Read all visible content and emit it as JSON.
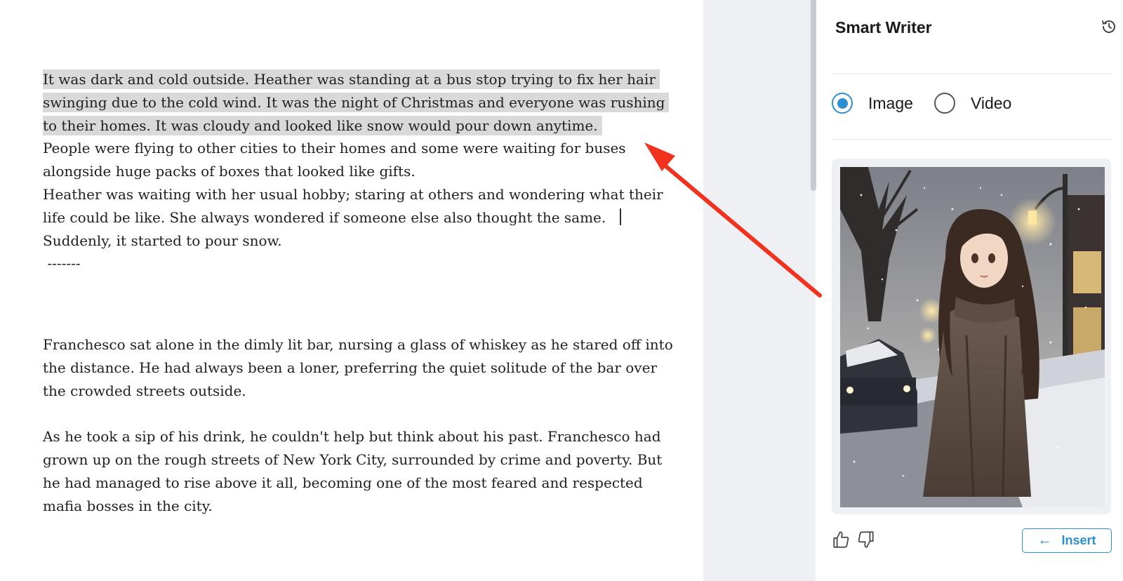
{
  "editor": {
    "highlighted_paragraph": "It was dark and cold outside. Heather was standing at a bus stop trying to fix her hair swinging due to the cold wind. It was the night of Christmas and everyone was rushing to their homes. It was cloudy and looked like snow would pour down anytime.",
    "paragraph_2": "People were flying to other cities to their homes and some were waiting for buses alongside huge packs of boxes that looked like gifts.",
    "paragraph_3": "Heather was waiting with her usual hobby; staring at others and wondering what their life could be like. She always wondered if someone else also thought the same.",
    "paragraph_4": "Suddenly, it started to pour snow.",
    "separator": " -------",
    "paragraph_5": "Franchesco sat alone in the dimly lit bar, nursing a glass of whiskey as he stared off into the distance. He had always been a loner, preferring the quiet solitude of the bar over the crowded streets outside.",
    "paragraph_6": "As he took a sip of his drink, he couldn't help but think about his past. Franchesco had grown up on the rough streets of New York City, surrounded by crime and poverty. But he had managed to rise above it all, becoming one of the most feared and respected mafia bosses in the city."
  },
  "panel": {
    "title": "Smart Writer",
    "history_icon": "history-icon",
    "media_options": [
      {
        "label": "Image",
        "selected": true
      },
      {
        "label": "Video",
        "selected": false
      }
    ],
    "generated_image_description_icon": "illustration",
    "like_icon": "thumbs-up-icon",
    "dislike_icon": "thumbs-down-icon",
    "insert_label": "Insert",
    "insert_icon": "arrow-left-icon"
  },
  "colors": {
    "accent": "#2e8fd0",
    "highlight": "#d9d9d9",
    "annotation_arrow": "#f0321e",
    "gutter": "#eef0f4"
  }
}
